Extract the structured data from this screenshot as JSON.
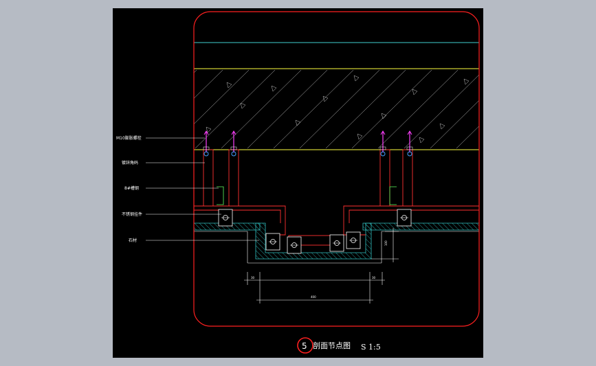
{
  "labels": [
    {
      "text": "M10膨胀螺栓"
    },
    {
      "text": "镀锌角码"
    },
    {
      "text": "8#槽钢"
    },
    {
      "text": "不锈钢挂件"
    },
    {
      "text": "石材"
    }
  ],
  "dimensions": {
    "left_small": "30",
    "right_small": "30",
    "bottom_width": "400",
    "right_height": "100"
  },
  "title_block": {
    "number": "5",
    "title": "剖面节点图",
    "scale": "S 1:5"
  },
  "colors": {
    "background": "#b6bbc4",
    "canvas": "#000000",
    "frame": "#ff2020",
    "concrete_edge": "#ffff40",
    "slab_top": "#40d0d0",
    "hatch": "#c8c8c8",
    "bolt": "#ff40ff",
    "stone": "#30c0c0",
    "steel": "#ff3030"
  }
}
